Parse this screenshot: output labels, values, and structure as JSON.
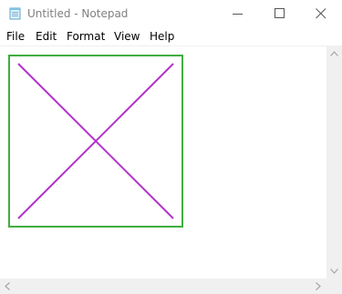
{
  "window": {
    "title": "Untitled - Notepad"
  },
  "menu": [
    "File",
    "Edit",
    "Format",
    "View",
    "Help"
  ],
  "icons": {
    "app": "notepad-icon",
    "minimize": "minimize-icon",
    "maximize": "maximize-icon",
    "close": "close-icon"
  },
  "colors": {
    "drawing_border": "#3fae3f",
    "drawing_cross": "#b233c8"
  }
}
